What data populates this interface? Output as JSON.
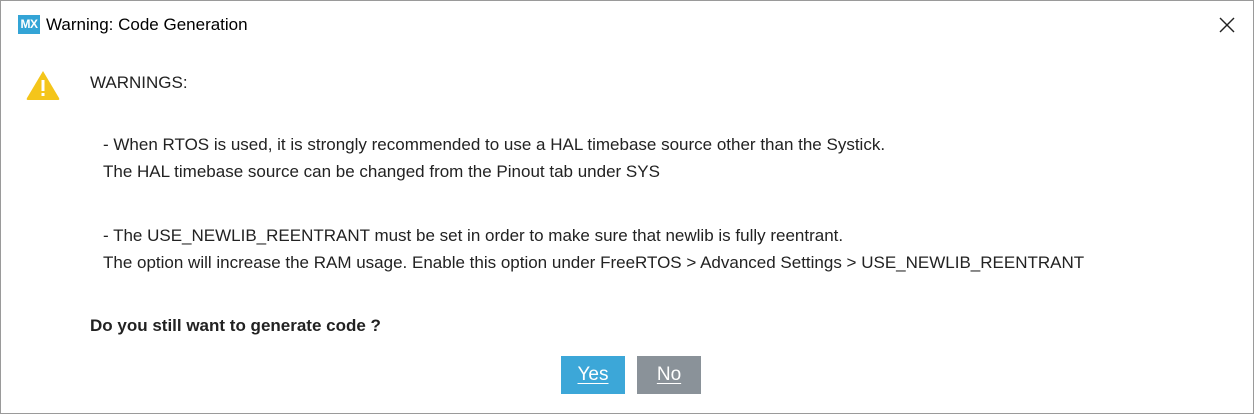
{
  "window": {
    "app_badge": "MX",
    "title": "Warning: Code Generation",
    "close_icon": "close-icon",
    "accent_color": "#33a4d6"
  },
  "content": {
    "icon": "warning-triangle-icon",
    "heading": "WARNINGS:",
    "warnings": [
      {
        "line1": "- When RTOS is used, it is strongly recommended to use a HAL timebase source other than the Systick.",
        "line2": "The HAL timebase source can be changed from the Pinout tab under SYS"
      },
      {
        "line1": "- The USE_NEWLIB_REENTRANT must be set in order to make sure that newlib is fully reentrant.",
        "line2": "The option will increase the RAM usage. Enable this option under FreeRTOS > Advanced Settings > USE_NEWLIB_REENTRANT"
      }
    ],
    "question": "Do you still want to generate code ?"
  },
  "buttons": {
    "yes_label": "Yes",
    "no_label": "No",
    "yes_color": "#3ca7d8",
    "no_color": "#8a9299"
  }
}
